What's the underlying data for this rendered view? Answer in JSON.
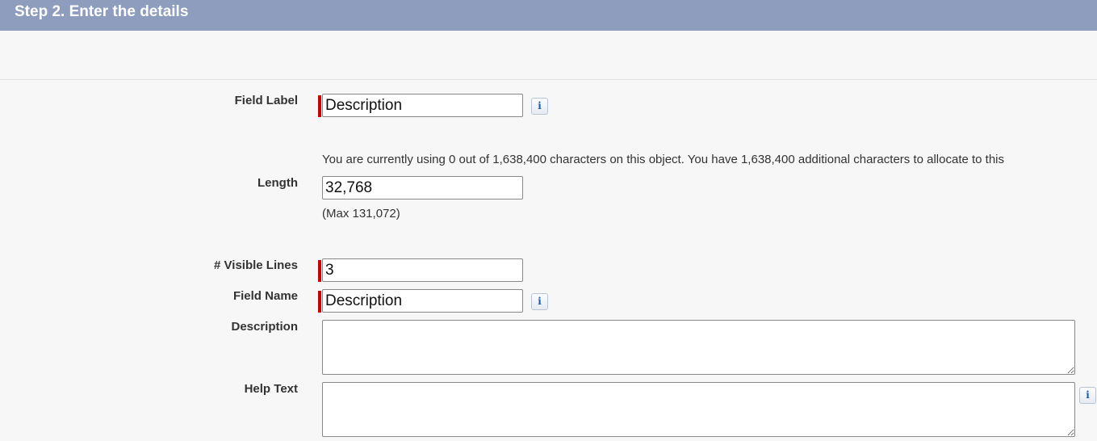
{
  "header": {
    "title": "Step 2. Enter the details"
  },
  "fields": {
    "field_label": {
      "label": "Field Label",
      "value": "Description"
    },
    "length": {
      "label": "Length",
      "usage_note": "You are currently using 0 out of 1,638,400 characters on this object. You have 1,638,400 additional characters to allocate to this",
      "value": "32,768",
      "max_note": "(Max 131,072)"
    },
    "visible_lines": {
      "label": "# Visible Lines",
      "value": "3"
    },
    "field_name": {
      "label": "Field Name",
      "value": "Description"
    },
    "description": {
      "label": "Description",
      "value": ""
    },
    "help_text": {
      "label": "Help Text",
      "value": ""
    }
  },
  "info_icon_glyph": "i",
  "colors": {
    "header_bg": "#8e9dbe",
    "required_marker": "#cc0000",
    "background": "#f7f7f7"
  }
}
